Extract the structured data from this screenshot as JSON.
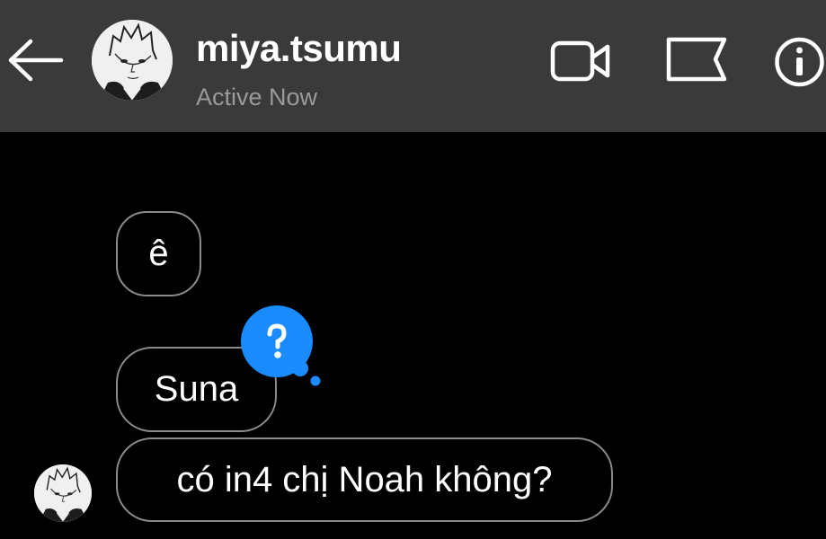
{
  "header": {
    "username": "miya.tsumu",
    "status": "Active Now",
    "background_color": "#3a3a3a"
  },
  "icons": {
    "back": "arrow-left-icon",
    "video": "video-camera-icon",
    "flag": "flag-icon",
    "info": "info-icon",
    "reaction": "question-thought-bubble-icon"
  },
  "messages": [
    {
      "text": "ê"
    },
    {
      "text": "Suna"
    },
    {
      "text": "có in4 chị Noah không?"
    }
  ],
  "reaction": {
    "symbol": "?",
    "color": "#1a8cff"
  }
}
